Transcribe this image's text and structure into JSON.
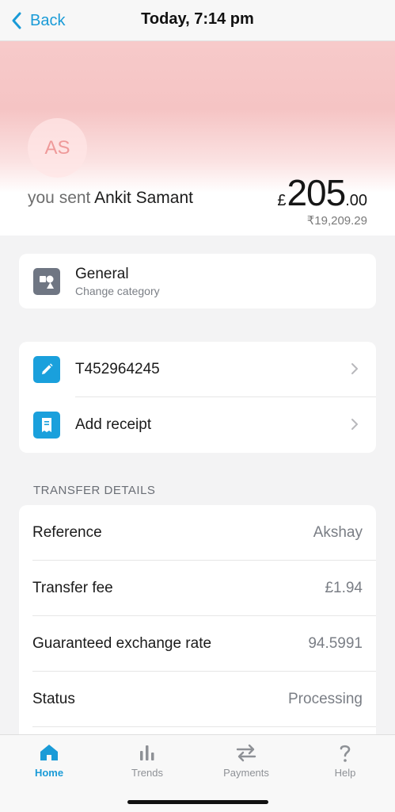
{
  "nav": {
    "back_label": "Back",
    "title": "Today, 7:14 pm"
  },
  "hero": {
    "avatar_initials": "AS",
    "sent_prefix": "you sent",
    "recipient_name": "Ankit Samant",
    "currency_symbol": "£",
    "amount_main": "205",
    "amount_decimal": ".00",
    "converted_amount": "₹19,209.29"
  },
  "category": {
    "title": "General",
    "subtitle": "Change category",
    "icon": "category-shapes-icon"
  },
  "actions": [
    {
      "label": "T452964245",
      "icon": "pencil-icon"
    },
    {
      "label": "Add receipt",
      "icon": "receipt-icon"
    }
  ],
  "transfer_details": {
    "heading": "TRANSFER DETAILS",
    "rows": [
      {
        "key": "Reference",
        "value": "Akshay"
      },
      {
        "key": "Transfer fee",
        "value": "£1.94"
      },
      {
        "key": "Guaranteed exchange rate",
        "value": "94.5991"
      },
      {
        "key": "Status",
        "value": "Processing"
      }
    ]
  },
  "tabs": [
    {
      "label": "Home",
      "icon": "home-icon",
      "active": true
    },
    {
      "label": "Trends",
      "icon": "bar-chart-icon",
      "active": false
    },
    {
      "label": "Payments",
      "icon": "transfer-arrows-icon",
      "active": false
    },
    {
      "label": "Help",
      "icon": "question-icon",
      "active": false
    }
  ],
  "colors": {
    "accent": "#1a9bd7",
    "hero_pink": "#f5c4c4",
    "avatar_text": "#ef9a9a",
    "category_icon_bg": "#6f7683",
    "action_icon_bg": "#1aa0dc"
  }
}
